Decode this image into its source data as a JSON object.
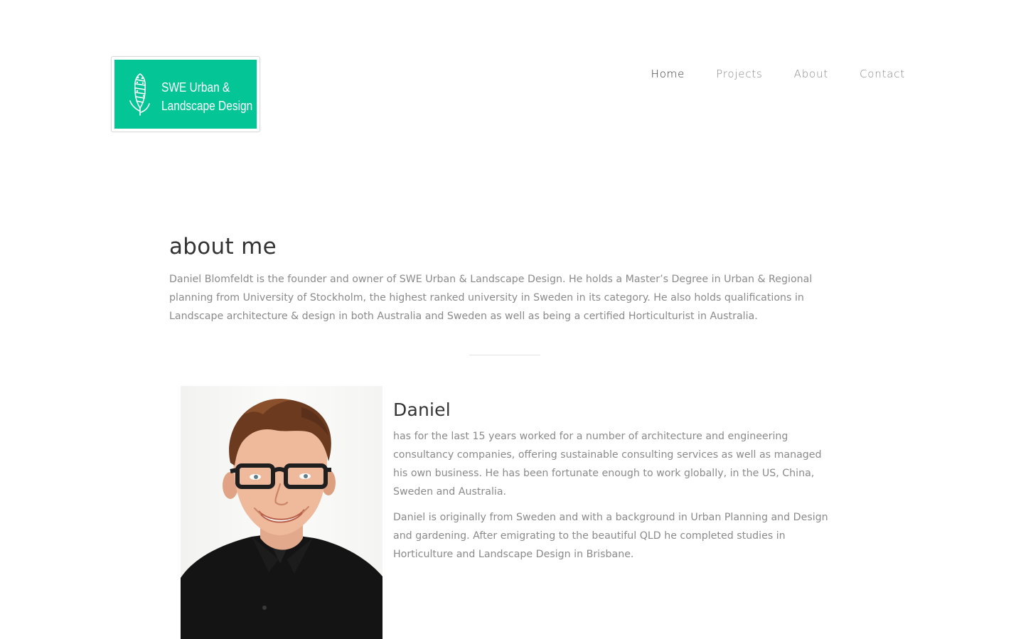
{
  "logo": {
    "line1": "SWE Urban &",
    "line2": "Landscape Design",
    "icon": "banksia-flower-icon",
    "background": "#04c595"
  },
  "nav": {
    "items": [
      {
        "label": "Home",
        "active": true
      },
      {
        "label": "Projects",
        "active": false
      },
      {
        "label": "About",
        "active": false
      },
      {
        "label": "Contact",
        "active": false
      }
    ]
  },
  "about": {
    "title": "about me",
    "text": "Daniel Blomfeldt is the founder and owner of SWE Urban & Landscape Design. He holds a Master’s Degree in Urban & Regional planning from University of Stockholm, the highest ranked university in Sweden in its category. He also holds qualifications in Landscape architecture & design in both Australia and Sweden as well as being a certified Horticulturist in Australia."
  },
  "person": {
    "name": "Daniel",
    "paragraph1": "has for the last 15 years worked for a number of architecture and engineering consultancy companies, offering sustainable consulting services as well as managed his own business. He has been fortunate enough to work globally, in the US, China, Sweden and Australia.",
    "paragraph2": "Daniel is originally from Sweden and with a background in Urban Planning and Design and gardening. After emigrating to the beautiful QLD he completed studies in Horticulture and Landscape Design in Brisbane."
  },
  "colors": {
    "heading": "#333333",
    "body_text": "#8a8a8a",
    "accent": "#04c595"
  }
}
